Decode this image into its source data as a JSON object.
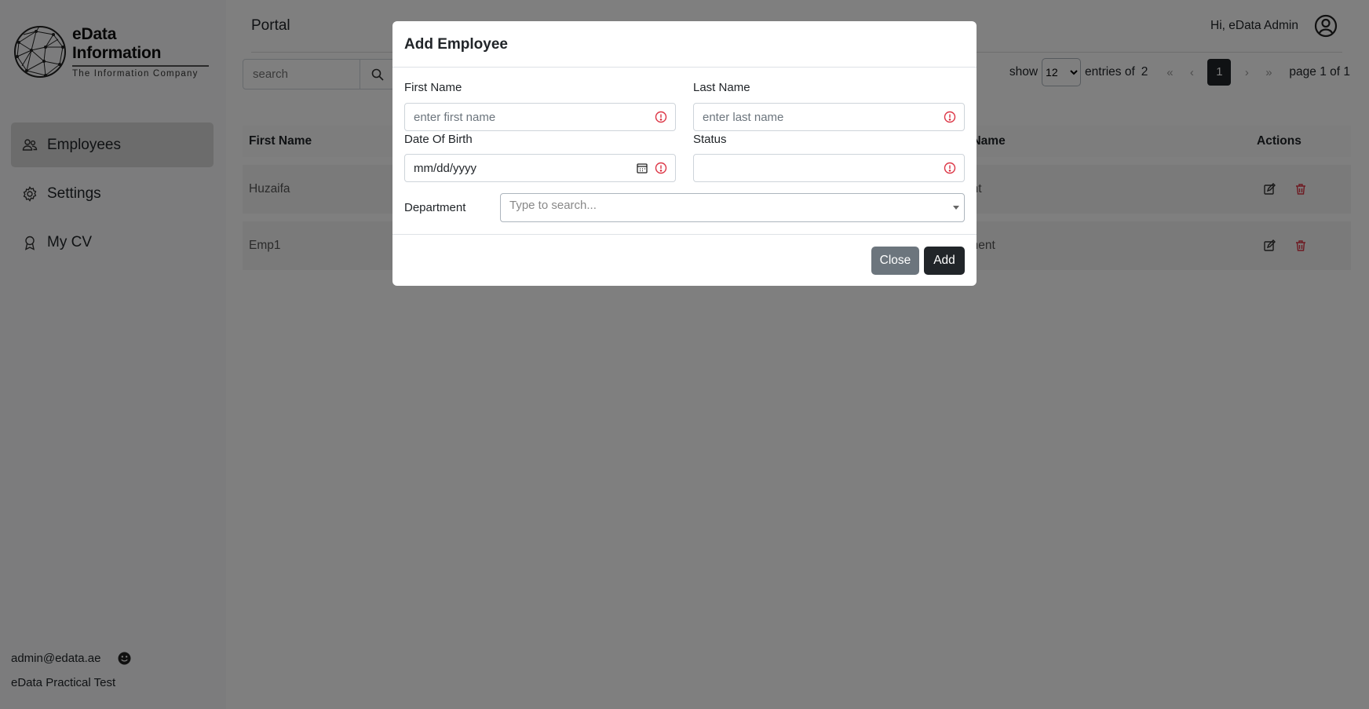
{
  "brand": {
    "title": "eData Information",
    "subtitle": "The Information Company"
  },
  "sidebar": {
    "items": [
      {
        "label": "Employees",
        "icon": "users-icon",
        "active": true
      },
      {
        "label": "Settings",
        "icon": "gear-icon",
        "active": false
      },
      {
        "label": "My CV",
        "icon": "award-icon",
        "active": false
      }
    ],
    "user_email": "admin@edata.ae",
    "app_name": "eData Practical Test"
  },
  "header": {
    "title": "Portal",
    "greeting": "Hi, eData Admin"
  },
  "search": {
    "placeholder": "search"
  },
  "pagination": {
    "show_label": "show",
    "page_size": "12",
    "entries_label": "entries of",
    "total": "2",
    "first": "«",
    "prev": "‹",
    "current": "1",
    "next": "›",
    "last": "»",
    "info": "page 1 of 1"
  },
  "table": {
    "headers": {
      "first_name": "First Name",
      "last_name": "t Name",
      "actions": "Actions"
    },
    "rows": [
      {
        "first_name": "Huzaifa",
        "last_col": "ent"
      },
      {
        "first_name": "Emp1",
        "last_col": "tment"
      }
    ]
  },
  "modal": {
    "title": "Add Employee",
    "first_name_label": "First Name",
    "first_name_placeholder": "enter first name",
    "last_name_label": "Last Name",
    "last_name_placeholder": "enter last name",
    "dob_label": "Date Of Birth",
    "dob_value": "mm/dd/yyyy",
    "status_label": "Status",
    "department_label": "Department",
    "department_placeholder": "Type to search...",
    "close_label": "Close",
    "add_label": "Add"
  },
  "colors": {
    "primary_dark": "#212529",
    "secondary": "#6c757d",
    "danger": "#dc3545"
  }
}
